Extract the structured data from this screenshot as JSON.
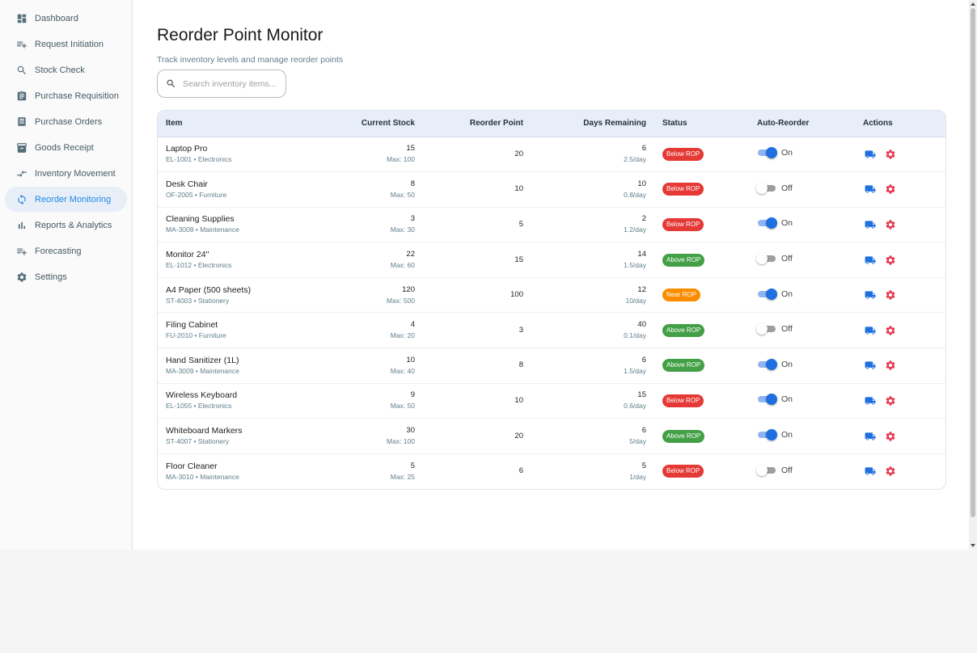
{
  "sidebar": {
    "items": [
      {
        "label": "Dashboard",
        "icon": "dashboard-icon",
        "active": false
      },
      {
        "label": "Request Initiation",
        "icon": "playlist-add-icon",
        "active": false
      },
      {
        "label": "Stock Check",
        "icon": "search-icon",
        "active": false
      },
      {
        "label": "Purchase Requisition",
        "icon": "clipboard-icon",
        "active": false
      },
      {
        "label": "Purchase Orders",
        "icon": "receipt-icon",
        "active": false
      },
      {
        "label": "Goods Receipt",
        "icon": "archive-icon",
        "active": false
      },
      {
        "label": "Inventory Movement",
        "icon": "compare-arrows-icon",
        "active": false
      },
      {
        "label": "Reorder Monitoring",
        "icon": "sync-icon",
        "active": true
      },
      {
        "label": "Reports & Analytics",
        "icon": "bar-chart-icon",
        "active": false
      },
      {
        "label": "Forecasting",
        "icon": "playlist-add-icon",
        "active": false
      },
      {
        "label": "Settings",
        "icon": "gear-icon",
        "active": false
      }
    ]
  },
  "header": {
    "title": "Reorder Point Monitor",
    "subtitle": "Track inventory levels and manage reorder points"
  },
  "search": {
    "placeholder": "Search inventory items...",
    "value": ""
  },
  "table": {
    "columns": {
      "item": "Item",
      "current_stock": "Current Stock",
      "reorder_point": "Reorder Point",
      "days_remaining": "Days Remaining",
      "status": "Status",
      "auto_reorder": "Auto-Reorder",
      "actions": "Actions"
    },
    "rows": [
      {
        "name": "Laptop Pro",
        "meta": "EL-1001 • Electronics",
        "stock": "15",
        "max": "Max: 100",
        "rop": "20",
        "days": "6",
        "rate": "2.5/day",
        "status": "Below ROP",
        "status_type": "below",
        "auto": "On",
        "auto_on": true
      },
      {
        "name": "Desk Chair",
        "meta": "OF-2005 • Furniture",
        "stock": "8",
        "max": "Max: 50",
        "rop": "10",
        "days": "10",
        "rate": "0.8/day",
        "status": "Below ROP",
        "status_type": "below",
        "auto": "Off",
        "auto_on": false
      },
      {
        "name": "Cleaning Supplies",
        "meta": "MA-3008 • Maintenance",
        "stock": "3",
        "max": "Max: 30",
        "rop": "5",
        "days": "2",
        "rate": "1.2/day",
        "status": "Below ROP",
        "status_type": "below",
        "auto": "On",
        "auto_on": true
      },
      {
        "name": "Monitor 24\"",
        "meta": "EL-1012 • Electronics",
        "stock": "22",
        "max": "Max: 60",
        "rop": "15",
        "days": "14",
        "rate": "1.5/day",
        "status": "Above ROP",
        "status_type": "above",
        "auto": "Off",
        "auto_on": false
      },
      {
        "name": "A4 Paper (500 sheets)",
        "meta": "ST-4003 • Stationery",
        "stock": "120",
        "max": "Max: 500",
        "rop": "100",
        "days": "12",
        "rate": "10/day",
        "status": "Near ROP",
        "status_type": "near",
        "auto": "On",
        "auto_on": true
      },
      {
        "name": "Filing Cabinet",
        "meta": "FU-2010 • Furniture",
        "stock": "4",
        "max": "Max: 20",
        "rop": "3",
        "days": "40",
        "rate": "0.1/day",
        "status": "Above ROP",
        "status_type": "above",
        "auto": "Off",
        "auto_on": false
      },
      {
        "name": "Hand Sanitizer (1L)",
        "meta": "MA-3009 • Maintenance",
        "stock": "10",
        "max": "Max: 40",
        "rop": "8",
        "days": "6",
        "rate": "1.5/day",
        "status": "Above ROP",
        "status_type": "above",
        "auto": "On",
        "auto_on": true
      },
      {
        "name": "Wireless Keyboard",
        "meta": "EL-1055 • Electronics",
        "stock": "9",
        "max": "Max: 50",
        "rop": "10",
        "days": "15",
        "rate": "0.6/day",
        "status": "Below ROP",
        "status_type": "below",
        "auto": "On",
        "auto_on": true
      },
      {
        "name": "Whiteboard Markers",
        "meta": "ST-4007 • Stationery",
        "stock": "30",
        "max": "Max: 100",
        "rop": "20",
        "days": "6",
        "rate": "5/day",
        "status": "Above ROP",
        "status_type": "above",
        "auto": "On",
        "auto_on": true
      },
      {
        "name": "Floor Cleaner",
        "meta": "MA-3010 • Maintenance",
        "stock": "5",
        "max": "Max: 25",
        "rop": "6",
        "days": "5",
        "rate": "1/day",
        "status": "Below ROP",
        "status_type": "below",
        "auto": "Off",
        "auto_on": false
      }
    ]
  },
  "colors": {
    "accent": "#1e88e5",
    "below": "#e53935",
    "above": "#43a047",
    "near": "#fb8c00",
    "action_reorder": "#1e6fe0",
    "action_settings": "#e53950"
  }
}
